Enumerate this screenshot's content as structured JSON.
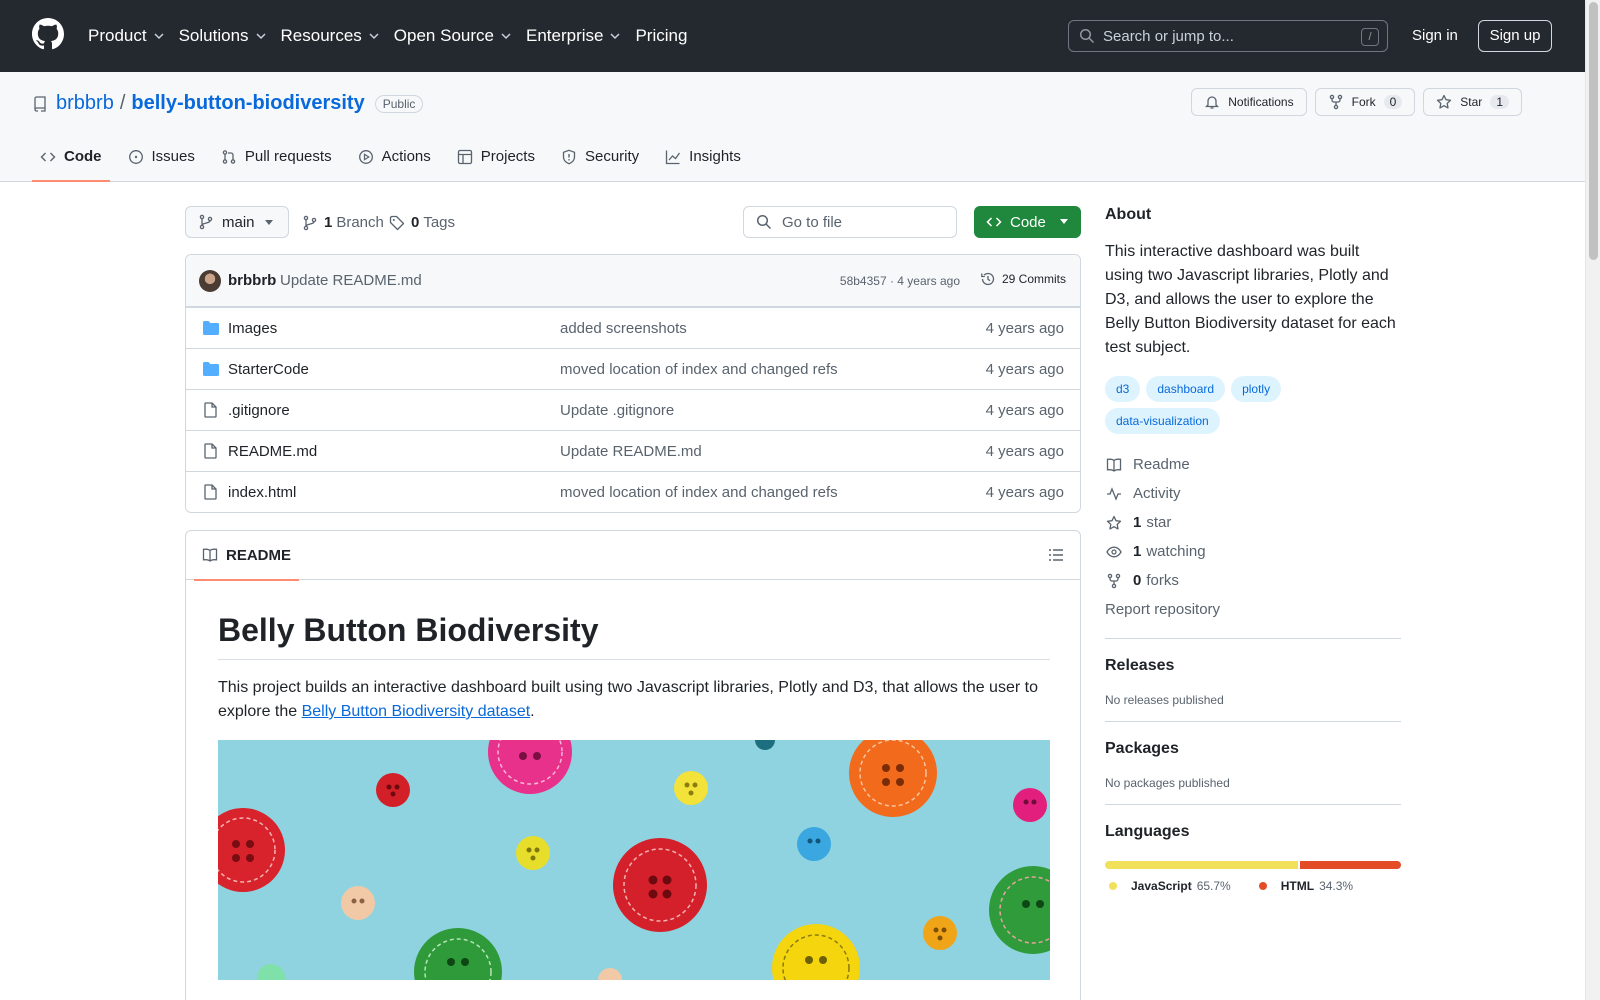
{
  "header": {
    "nav": [
      "Product",
      "Solutions",
      "Resources",
      "Open Source",
      "Enterprise",
      "Pricing"
    ],
    "search_placeholder": "Search or jump to...",
    "search_shortcut": "/",
    "sign_in": "Sign in",
    "sign_up": "Sign up"
  },
  "repo": {
    "owner": "brbbrb",
    "separator": "/",
    "name": "belly-button-biodiversity",
    "visibility": "Public",
    "actions": {
      "notifications": "Notifications",
      "fork": "Fork",
      "fork_count": "0",
      "star": "Star",
      "star_count": "1"
    },
    "tabs": [
      "Code",
      "Issues",
      "Pull requests",
      "Actions",
      "Projects",
      "Security",
      "Insights"
    ]
  },
  "toolbar": {
    "branch": "main",
    "branch_count": "1",
    "branch_label": "Branch",
    "tag_count": "0",
    "tag_label": "Tags",
    "goto_file": "Go to file",
    "code_button": "Code"
  },
  "commit": {
    "author": "brbbrb",
    "message": "Update README.md",
    "meta": "58b4357 · 4 years ago",
    "commits": "29 Commits"
  },
  "files": [
    {
      "name": "Images",
      "type": "folder",
      "message": "added screenshots",
      "age": "4 years ago"
    },
    {
      "name": "StarterCode",
      "type": "folder",
      "message": "moved location of index and changed refs",
      "age": "4 years ago"
    },
    {
      "name": ".gitignore",
      "type": "file",
      "message": "Update .gitignore",
      "age": "4 years ago"
    },
    {
      "name": "README.md",
      "type": "file",
      "message": "Update README.md",
      "age": "4 years ago"
    },
    {
      "name": "index.html",
      "type": "file",
      "message": "moved location of index and changed refs",
      "age": "4 years ago"
    }
  ],
  "readme": {
    "tab": "README",
    "title": "Belly Button Biodiversity",
    "text_before": "This project builds an interactive dashboard built using two Javascript libraries, Plotly and D3, that allows the user to explore the ",
    "link": "Belly Button Biodiversity dataset",
    "text_after": "."
  },
  "about": {
    "heading": "About",
    "description": "This interactive dashboard was built using two Javascript libraries, Plotly and D3, and allows the user to explore the Belly Button Biodiversity dataset for each test subject.",
    "topics": [
      "d3",
      "dashboard",
      "plotly",
      "data-visualization"
    ],
    "readme": "Readme",
    "activity": "Activity",
    "stars_count": "1",
    "stars_label": "star",
    "watching_count": "1",
    "watching_label": "watching",
    "forks_count": "0",
    "forks_label": "forks",
    "report": "Report repository"
  },
  "releases": {
    "heading": "Releases",
    "text": "No releases published"
  },
  "packages": {
    "heading": "Packages",
    "text": "No packages published"
  },
  "languages": {
    "heading": "Languages",
    "items": [
      {
        "name": "JavaScript",
        "percent": "65.7%",
        "value": 65.7,
        "color": "#f1e05a"
      },
      {
        "name": "HTML",
        "percent": "34.3%",
        "value": 34.3,
        "color": "#e34c26"
      }
    ]
  },
  "colors": {
    "header_bg": "#24292f",
    "link": "#0969da",
    "code_button": "#1f883d",
    "tab_underline": "#fd8c73"
  }
}
